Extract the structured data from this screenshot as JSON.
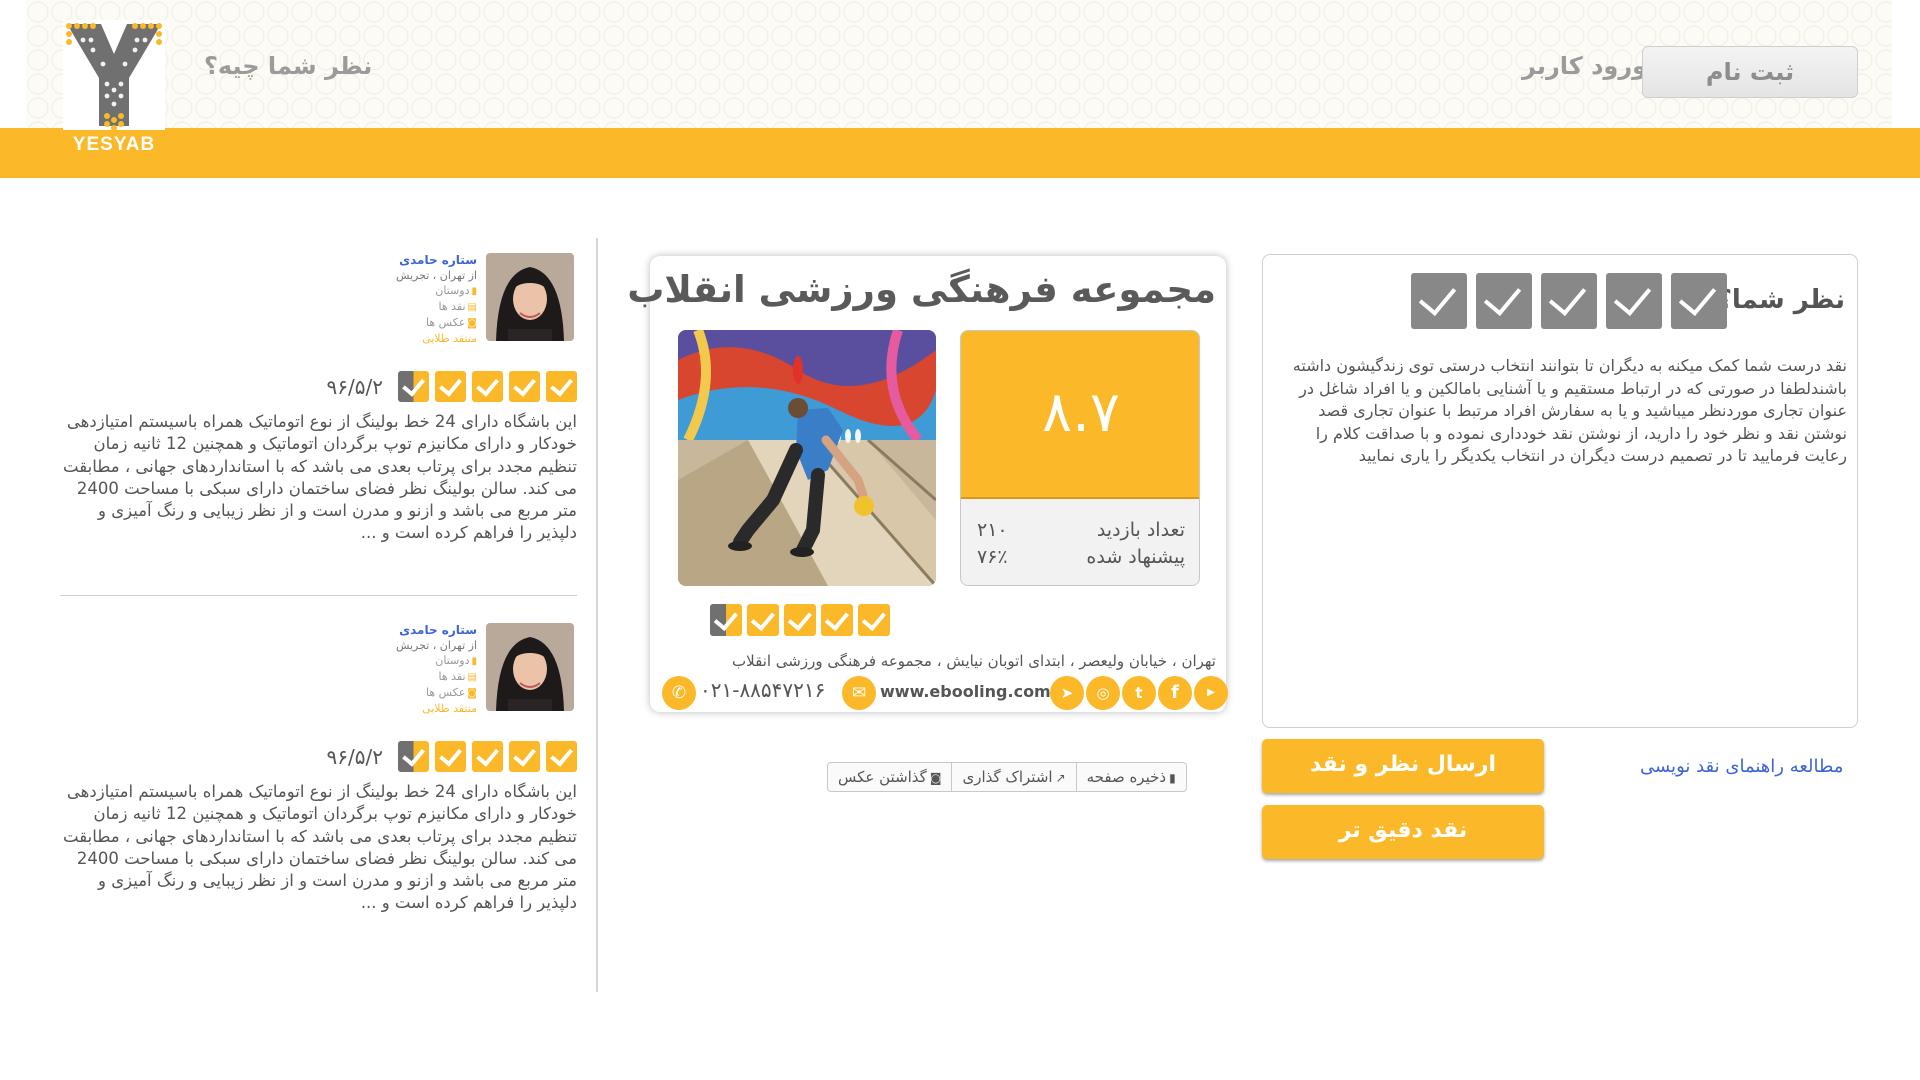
{
  "header": {
    "logo_text": "YESYAB",
    "question": "نظر شما چیه؟",
    "login": "ورود کاربر",
    "signup": "ثبت نام"
  },
  "opinion": {
    "title": "نظر شما؟",
    "text": "نقد درست شما کمک میکنه به دیگران تا بتوانند انتخاب درستی توی زندگیشون داشته باشندلطفا در صورتی که در ارتباط مستقیم و یا آشنایی بامالکین و یا افراد شاغل در عنوان تجاری موردنظر میباشید و یا به سفارش افراد مرتبط با عنوان تجاری قصد نوشتن نقد و نظر خود را دارید، از نوشتن نقد خودداری نموده و با صداقت کلام را رعایت فرمایید تا در تصمیم درست دیگران در انتخاب یکدیگر را یاری نمایید",
    "guide_link": "مطالعه راهنمای نقد نویسی",
    "submit": "ارسال نظر و نقد",
    "precise": "نقد دقیق تر"
  },
  "venue": {
    "title": "مجموعه فرهنگی ورزشی انقلاب",
    "score": "۸.۷",
    "visits_label": "تعداد بازدید",
    "visits_value": "۲۱۰",
    "recommend_label": "پیشنهاد شده",
    "recommend_value": "۷۶٪",
    "address": "تهران ، خیابان ولیعصر ، ابتدای اتوبان نیایش ، مجموعه فرهنگی ورزشی انقلاب",
    "phone": "۰۲۱-۸۸۵۴۷۲۱۶",
    "website": "www.ebooling.com"
  },
  "actions": {
    "save": "ذخیره صفحه",
    "share": "اشتراک گذاری",
    "photo": "گذاشتن عکس"
  },
  "reviews": [
    {
      "name": "ستاره حامدی",
      "location": "از تهران ، تجریش",
      "friends": "دوستان",
      "reviews": "نقد ها",
      "photos": "عکس ها",
      "badge": "منتقد طلایی",
      "date": "۹۶/۵/۲",
      "rating": 4.5,
      "text": "این باشگاه دارای 24 خط بولینگ از نوع اتوماتیک همراه باسیستم امتیازدهی خودکار و دارای مکانیزم توپ برگردان اتوماتیک و همچنین 12 ثانیه زمان تنظیم مجدد برای پرتاب بعدی می باشد که با استانداردهای جهانی ، مطابقت می کند. سالن بولینگ نظر فضای ساختمان دارای سبکی با مساحت 2400 متر مربع می باشد و ازنو و مدرن است و از نظر زیبایی و رنگ آمیزی و دلپذیر را فراهم کرده است و ..."
    },
    {
      "name": "ستاره حامدی",
      "location": "از تهران ، تجریش",
      "friends": "دوستان",
      "reviews": "نقد ها",
      "photos": "عکس ها",
      "badge": "منتقد طلایی",
      "date": "۹۶/۵/۲",
      "rating": 4.5,
      "text": "این باشگاه دارای 24 خط بولینگ از نوع اتوماتیک همراه باسیستم امتیازدهی خودکار و دارای مکانیزم توپ برگردان اتوماتیک و همچنین 12 ثانیه زمان تنظیم مجدد برای پرتاب بعدی می باشد که با استانداردهای جهانی ، مطابقت می کند. سالن بولینگ نظر فضای ساختمان دارای سبکی با مساحت 2400 متر مربع می باشد و ازنو و مدرن است و از نظر زیبایی و رنگ آمیزی و دلپذیر را فراهم کرده است و ..."
    }
  ],
  "venue_rating": 4.5,
  "colors": {
    "accent": "#fbb829",
    "link": "#3b64d8",
    "check_gray": "#707070"
  }
}
